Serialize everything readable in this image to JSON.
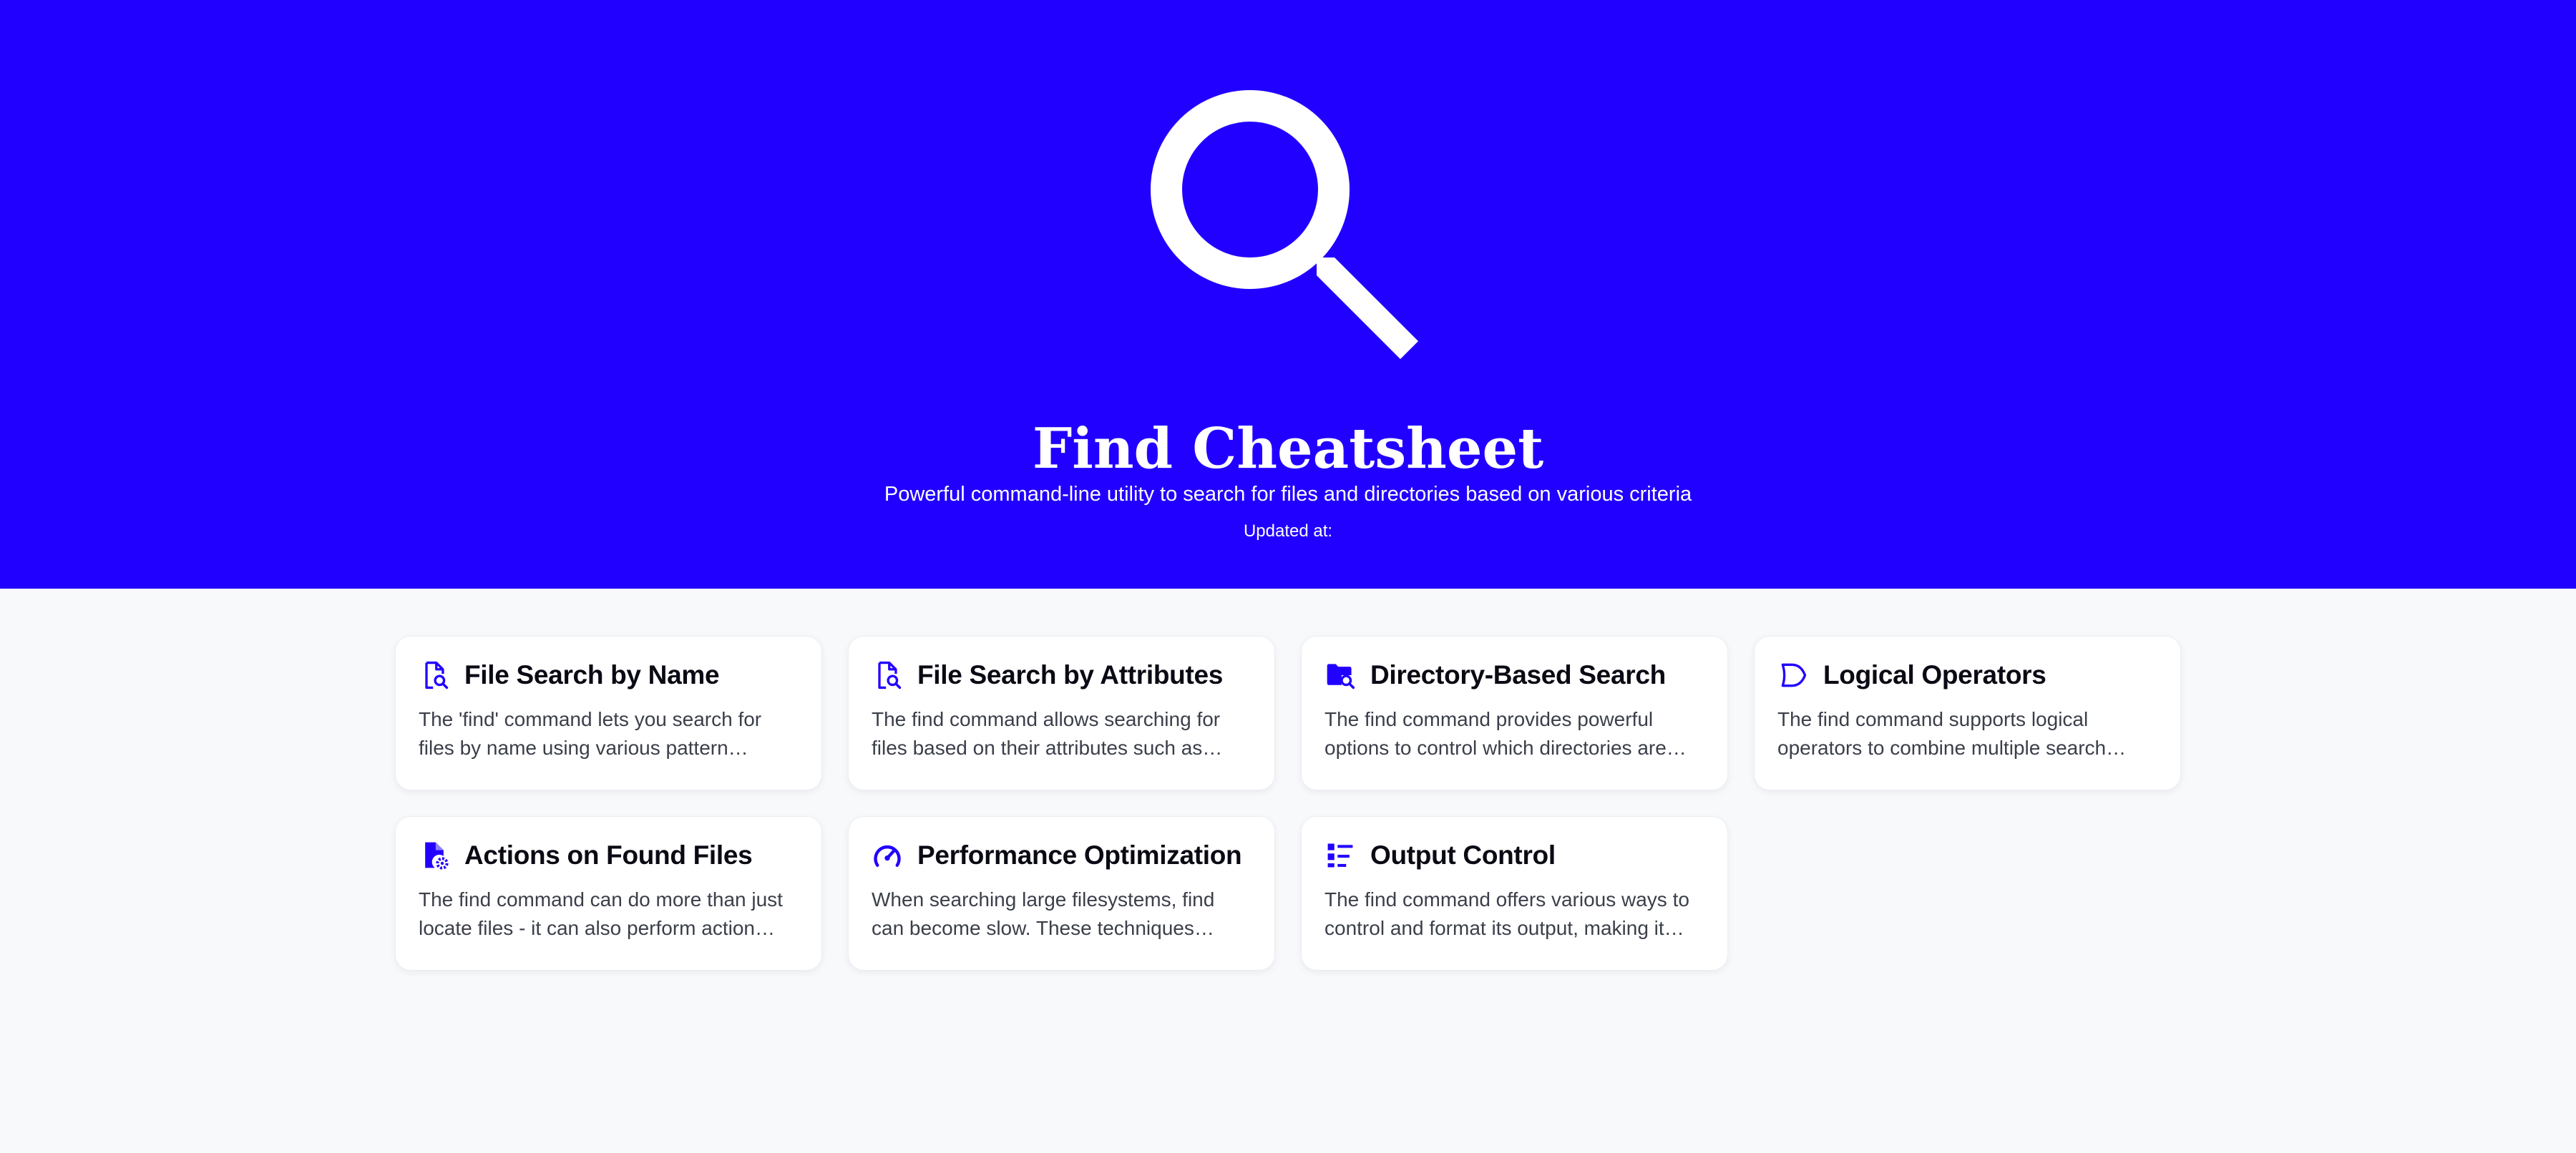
{
  "header": {
    "icon": "magnifying-glass-icon",
    "title": "Find Cheatsheet",
    "subtitle": "Powerful command-line utility to search for files and directories based on various criteria",
    "updated_label": "Updated at:"
  },
  "colors": {
    "brand": "#2200ff",
    "background": "#f8f9fb",
    "card_background": "#ffffff",
    "title_text": "#0a0a14",
    "body_text": "#3b3f4a"
  },
  "cards": [
    {
      "icon": "file-search-icon",
      "title": "File Search by Name",
      "description": "The 'find' command lets you search for files by name using various pattern…"
    },
    {
      "icon": "file-search-icon",
      "title": "File Search by Attributes",
      "description": "The find command allows searching for files based on their attributes such as…"
    },
    {
      "icon": "folder-search-icon",
      "title": "Directory-Based Search",
      "description": "The find command provides powerful options to control which directories are…"
    },
    {
      "icon": "logic-gate-icon",
      "title": "Logical Operators",
      "description": "The find command supports logical operators to combine multiple search…"
    },
    {
      "icon": "file-settings-icon",
      "title": "Actions on Found Files",
      "description": "The find command can do more than just locate files - it can also perform action…"
    },
    {
      "icon": "speedometer-icon",
      "title": "Performance Optimization",
      "description": "When searching large filesystems, find can become slow. These techniques…"
    },
    {
      "icon": "list-format-icon",
      "title": "Output Control",
      "description": "The find command offers various ways to control and format its output, making it…"
    }
  ]
}
